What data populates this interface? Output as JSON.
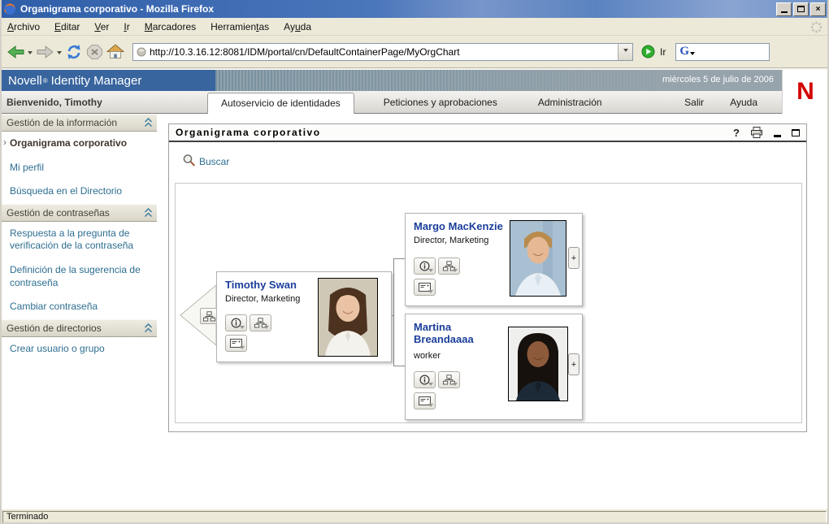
{
  "colors": {
    "titlebar_blue": "#4a76bb",
    "chrome_gray": "#ece9d8",
    "banner_blue": "#38659e",
    "novell_red": "#d40000",
    "link_teal": "#2e6e91",
    "card_name_blue": "#1b3e9b",
    "active_sidebar_item": "#40352c"
  },
  "titlebar": {
    "title": "Organigrama corporativo - Mozilla Firefox"
  },
  "menubar": {
    "items": [
      {
        "pre": "",
        "key": "A",
        "post": "rchivo"
      },
      {
        "pre": "",
        "key": "E",
        "post": "ditar"
      },
      {
        "pre": "",
        "key": "V",
        "post": "er"
      },
      {
        "pre": "",
        "key": "I",
        "post": "r"
      },
      {
        "pre": "",
        "key": "M",
        "post": "arcadores"
      },
      {
        "pre": "Herramien",
        "key": "t",
        "post": "as"
      },
      {
        "pre": "Ay",
        "key": "u",
        "post": "da"
      }
    ]
  },
  "toolbar": {
    "url": "http://10.3.16.12:8081/IDM/portal/cn/DefaultContainerPage/MyOrgChart",
    "go_label": "Ir",
    "search_logo": "G"
  },
  "banner": {
    "brand": "Novell",
    "registered": "®",
    "product": "Identity Manager",
    "date": "miércoles 5 de julio de 2006",
    "logo_letter": "N"
  },
  "header": {
    "welcome": "Bienvenido, Timothy"
  },
  "tabs": [
    {
      "label": "Autoservicio de identidades",
      "active": true
    },
    {
      "label": "Peticiones y aprobaciones",
      "active": false
    },
    {
      "label": "Administración",
      "active": false
    },
    {
      "label": "Salir",
      "active": false
    },
    {
      "label": "Ayuda",
      "active": false
    }
  ],
  "sidebar": {
    "sections": [
      {
        "title": "Gestión de la información",
        "items": [
          {
            "label": "Organigrama corporativo",
            "active": true
          },
          {
            "label": "Mi perfil",
            "active": false
          },
          {
            "label": "Búsqueda en el Directorio",
            "active": false
          }
        ]
      },
      {
        "title": "Gestión de contraseñas",
        "items": [
          {
            "label": "Respuesta a la pregunta de verificación de la contraseña",
            "active": false
          },
          {
            "label": "Definición de la sugerencia de contraseña",
            "active": false
          },
          {
            "label": "Cambiar contraseña",
            "active": false
          }
        ]
      },
      {
        "title": "Gestión de directorios",
        "items": [
          {
            "label": "Crear usuario o grupo",
            "active": false
          }
        ]
      }
    ]
  },
  "portlet": {
    "title": "Organigrama corporativo",
    "help": "?",
    "search_label": "Buscar"
  },
  "orgchart": {
    "cards": [
      {
        "name": "Timothy Swan",
        "title": "Director, Marketing"
      },
      {
        "name": "Margo MacKenzie",
        "title": "Director, Marketing",
        "expand": "+"
      },
      {
        "name": "Martina Breandaaaa",
        "title": "worker",
        "expand": "+"
      }
    ],
    "active_bullet": "›"
  },
  "statusbar": {
    "text": "Terminado"
  }
}
